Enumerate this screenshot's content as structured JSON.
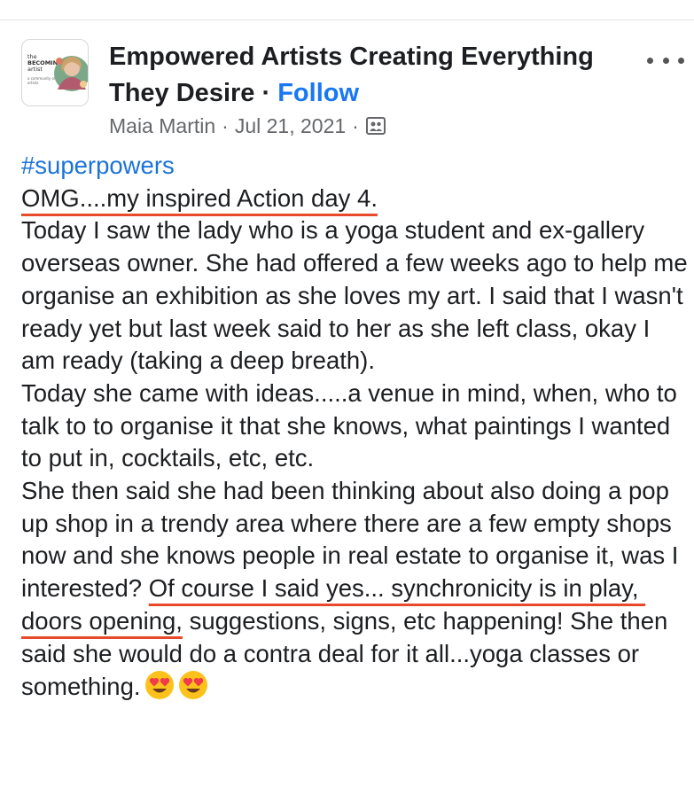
{
  "post": {
    "avatar": {
      "logo_line1": "the",
      "logo_line2": "BECOMING",
      "logo_line3": "artist",
      "logo_tagline": "a community of artists"
    },
    "group_name": "Empowered Artists Creating Everything They Desire",
    "separator": "·",
    "follow_label": "Follow",
    "author": "Maia Martin",
    "date": "Jul 21, 2021",
    "privacy_icon": "group-members-icon",
    "more_icon": "more-options-icon"
  },
  "content": {
    "hashtag": "#superpowers",
    "headline": "OMG....my inspired Action day 4.",
    "paragraph1": "Today I saw the lady who is a yoga student and ex-gallery overseas owner. She had offered a few weeks ago to help me organise an exhibition as she loves my art. I said that I wasn't ready yet but last week said to her as she left class, okay I am ready (taking a deep breath).",
    "paragraph2": "Today she came with ideas.....a venue in mind, when, who to talk to to organise it that she knows, what paintings I wanted to put in, cocktails, etc, etc.",
    "paragraph3_start": "She then said she had been thinking about also doing a pop up shop in a trendy area where there are a few empty shops now and she knows people in real estate to organise it, was I interested? ",
    "paragraph3_highlight": "Of course I said yes... synchronicity is in play, doors opening,",
    "paragraph3_end": " suggestions, signs, etc happening! She then said she would do a contra deal for it all...yoga classes or something.",
    "emojis": [
      "heart-eyes-emoji",
      "heart-eyes-emoji"
    ]
  },
  "colors": {
    "link_blue": "#1877f2",
    "hashtag_blue": "#1a73d9",
    "underline_red": "#e8492a",
    "meta_gray": "#65676b"
  }
}
